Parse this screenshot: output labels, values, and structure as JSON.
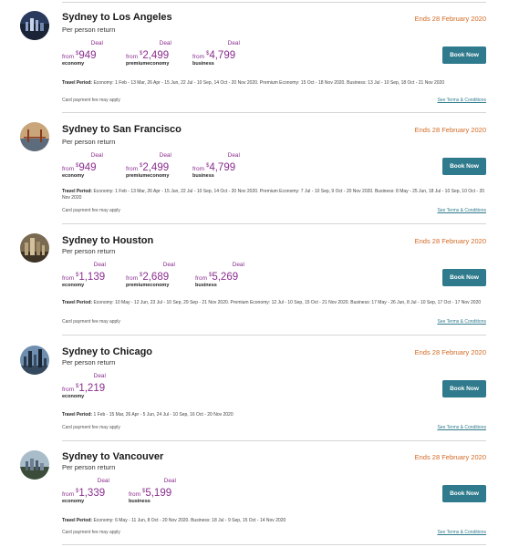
{
  "offers": [
    {
      "title": "Sydney to Los Angeles",
      "subtitle": "Per person return",
      "ends": "Ends 28 February 2020",
      "fares": [
        {
          "deal": "Deal",
          "from": "from",
          "currency": "$",
          "amount": "949",
          "cls": "economy"
        },
        {
          "deal": "Deal",
          "from": "from",
          "currency": "$",
          "amount": "2,499",
          "cls": "premiumeconomy"
        },
        {
          "deal": "Deal",
          "from": "from",
          "currency": "$",
          "amount": "4,799",
          "cls": "business"
        }
      ],
      "book": "Book Now",
      "travel_label": "Travel Period:",
      "travel_text": "Economy: 1 Feb - 13 Mar, 26 Apr - 15 Jun, 22 Jul - 10 Sep, 14 Oct - 20 Nov 2020. Premium Economy: 15 Oct - 18 Nov 2020. Business: 13 Jul - 10 Sep, 18 Oct - 21 Nov 2020",
      "card_fee": "Card payment fee may apply",
      "terms": "See Terms & Conditions"
    },
    {
      "title": "Sydney to San Francisco",
      "subtitle": "Per person return",
      "ends": "Ends 28 February 2020",
      "fares": [
        {
          "deal": "Deal",
          "from": "from",
          "currency": "$",
          "amount": "949",
          "cls": "economy"
        },
        {
          "deal": "Deal",
          "from": "from",
          "currency": "$",
          "amount": "2,499",
          "cls": "premiumeconomy"
        },
        {
          "deal": "Deal",
          "from": "from",
          "currency": "$",
          "amount": "4,799",
          "cls": "business"
        }
      ],
      "book": "Book Now",
      "travel_label": "Travel Period:",
      "travel_text": "Economy: 1 Feb - 13 Mar, 26 Apr - 15 Jun, 22 Jul - 10 Sep, 14 Oct - 20 Nov 2020. Premium Economy: 7 Jul - 10 Sep, 9 Oct - 20 Nov 2020. Business: 8 May - 25 Jun, 18 Jul - 10 Sep, 10 Oct - 20 Nov 2020",
      "card_fee": "Card payment fee may apply",
      "terms": "See Terms & Conditions"
    },
    {
      "title": "Sydney to Houston",
      "subtitle": "Per person return",
      "ends": "Ends 28 February 2020",
      "fares": [
        {
          "deal": "Deal",
          "from": "from",
          "currency": "$",
          "amount": "1,139",
          "cls": "economy"
        },
        {
          "deal": "Deal",
          "from": "from",
          "currency": "$",
          "amount": "2,689",
          "cls": "premiumeconomy"
        },
        {
          "deal": "Deal",
          "from": "from",
          "currency": "$",
          "amount": "5,269",
          "cls": "business"
        }
      ],
      "book": "Book Now",
      "travel_label": "Travel Period:",
      "travel_text": "Economy: 10 May - 12 Jun, 23 Jul - 10 Sep, 29 Sep - 21 Nov 2020. Premium Economy: 12 Jul - 10 Sep, 15 Oct - 21 Nov 2020. Business: 17 May - 26 Jun, 8 Jul - 10 Sep, 17 Oct - 17 Nov 2020",
      "card_fee": "Card payment fee may apply",
      "terms": "See Terms & Conditions"
    },
    {
      "title": "Sydney to Chicago",
      "subtitle": "Per person return",
      "ends": "Ends 28 February 2020",
      "fares": [
        {
          "deal": "Deal",
          "from": "from",
          "currency": "$",
          "amount": "1,219",
          "cls": "economy"
        }
      ],
      "book": "Book Now",
      "travel_label": "Travel Period:",
      "travel_text": "1 Feb - 15 Mar, 26 Apr - 5 Jun, 24 Jul - 10 Sep, 16 Oct - 20 Nov 2020",
      "card_fee": "Card payment fee may apply",
      "terms": "See Terms & Conditions"
    },
    {
      "title": "Sydney to Vancouver",
      "subtitle": "Per person return",
      "ends": "Ends 28 February 2020",
      "fares": [
        {
          "deal": "Deal",
          "from": "from",
          "currency": "$",
          "amount": "1,339",
          "cls": "economy"
        },
        {
          "deal": "Deal",
          "from": "from",
          "currency": "$",
          "amount": "5,199",
          "cls": "business"
        }
      ],
      "book": "Book Now",
      "travel_label": "Travel Period:",
      "travel_text": "Economy: 6 May - 11 Jun, 8 Oct - 20 Nov 2020. Business: 18 Jul - 9 Sep, 15 Oct - 14 Nov 2020",
      "card_fee": "Card payment fee may apply",
      "terms": "See Terms & Conditions"
    }
  ],
  "colors": {
    "deal_purple": "#8a2d8e",
    "ends_orange": "#d26a25",
    "button_teal": "#2f7a8c"
  }
}
